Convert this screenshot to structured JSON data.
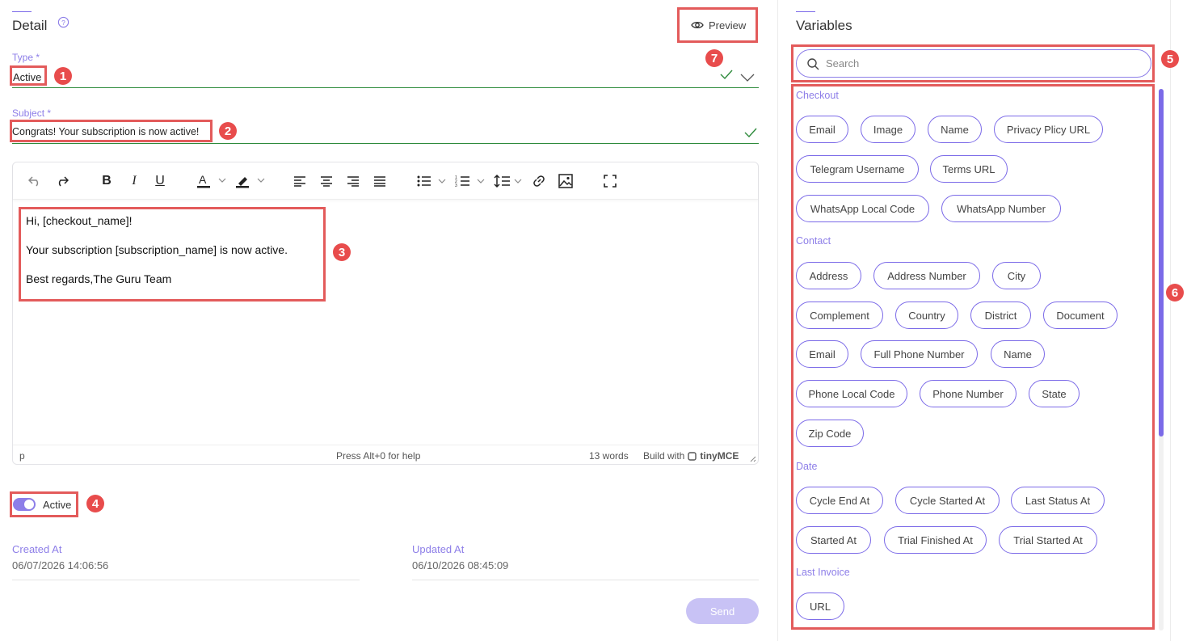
{
  "detail": {
    "title": "Detail",
    "preview_label": "Preview",
    "type_label": "Type *",
    "type_value": "Active",
    "subject_label": "Subject *",
    "subject_value": "Congrats! Your subscription is now active!",
    "body_lines": [
      "Hi, [checkout_name]!",
      "Your subscription [subscription_name] is now active.",
      "Best regards,The Guru Team"
    ],
    "status_path": "p",
    "status_help": "Press Alt+0 for help",
    "status_words": "13 words",
    "status_build": "Build with",
    "status_brand": "tinyMCE",
    "active_label": "Active",
    "created_label": "Created At",
    "created_value": "06/07/2026 14:06:56",
    "updated_label": "Updated At",
    "updated_value": "06/10/2026 08:45:09",
    "send_label": "Send"
  },
  "badges": [
    "1",
    "2",
    "3",
    "4",
    "5",
    "6",
    "7"
  ],
  "variables": {
    "title": "Variables",
    "search_placeholder": "Search",
    "groups": [
      {
        "name": "Checkout",
        "chips": [
          "Email",
          "Image",
          "Name",
          "Privacy Plicy URL",
          "Telegram Username",
          "Terms URL",
          "WhatsApp Local Code",
          "WhatsApp Number"
        ]
      },
      {
        "name": "Contact",
        "chips": [
          "Address",
          "Address Number",
          "City",
          "Complement",
          "Country",
          "District",
          "Document",
          "Email",
          "Full Phone Number",
          "Name",
          "Phone Local Code",
          "Phone Number",
          "State",
          "Zip Code"
        ]
      },
      {
        "name": "Date",
        "chips": [
          "Cycle End At",
          "Cycle Started At",
          "Last Status At",
          "Started At",
          "Trial Finished At",
          "Trial Started At"
        ]
      },
      {
        "name": "Last Invoice",
        "chips": [
          "URL"
        ]
      }
    ]
  },
  "colors": {
    "accent": "#7b6ae8",
    "highlight": "#e35b5b",
    "valid": "#2e8b3c"
  }
}
